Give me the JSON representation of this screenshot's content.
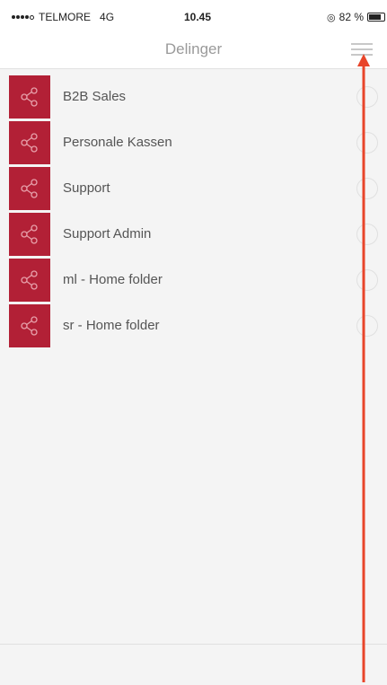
{
  "status_bar": {
    "carrier": "TELMORE",
    "network": "4G",
    "time": "10.45",
    "battery_percent": "82 %",
    "battery_level": 0.82,
    "signal_bars_filled": 4,
    "signal_bars_total": 5
  },
  "nav": {
    "title": "Delinger",
    "menu_icon": "hamburger-menu-icon"
  },
  "shares": {
    "items": [
      {
        "label": "B2B Sales",
        "icon": "share-icon"
      },
      {
        "label": "Personale Kassen",
        "icon": "share-icon"
      },
      {
        "label": "Support",
        "icon": "share-icon"
      },
      {
        "label": "Support Admin",
        "icon": "share-icon"
      },
      {
        "label": "ml - Home folder",
        "icon": "share-icon"
      },
      {
        "label": "sr - Home folder",
        "icon": "share-icon"
      }
    ]
  },
  "colors": {
    "accent": "#b22036",
    "annotation_arrow": "#e8452a",
    "list_background": "#f4f4f4"
  }
}
